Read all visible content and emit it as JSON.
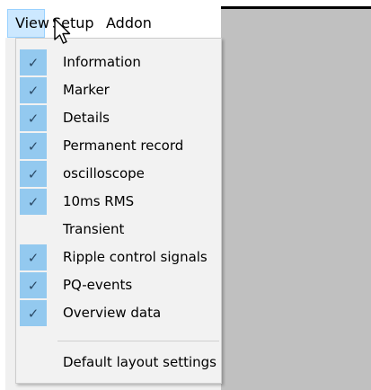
{
  "menubar": {
    "items": [
      {
        "label": "View"
      },
      {
        "label": "Setup"
      },
      {
        "label": "Addon"
      }
    ]
  },
  "view_menu": {
    "items": [
      {
        "label": "Information",
        "checked": true
      },
      {
        "label": "Marker",
        "checked": true
      },
      {
        "label": "Details",
        "checked": true
      },
      {
        "label": "Permanent record",
        "checked": true
      },
      {
        "label": "oscilloscope",
        "checked": true
      },
      {
        "label": "10ms RMS",
        "checked": true
      },
      {
        "label": "Transient",
        "checked": false
      },
      {
        "label": "Ripple control signals",
        "checked": true
      },
      {
        "label": "PQ-events",
        "checked": true
      },
      {
        "label": "Overview data",
        "checked": true
      }
    ],
    "footer_item": {
      "label": "Default layout settings"
    }
  },
  "icons": {
    "check": "checkmark-icon",
    "cursor": "mouse-pointer-icon"
  },
  "colors": {
    "check_highlight": "#93c9ef",
    "menubar_active_bg": "#cce8ff",
    "menu_bg": "#f2f2f2",
    "background_gray": "#c0c0c0"
  }
}
